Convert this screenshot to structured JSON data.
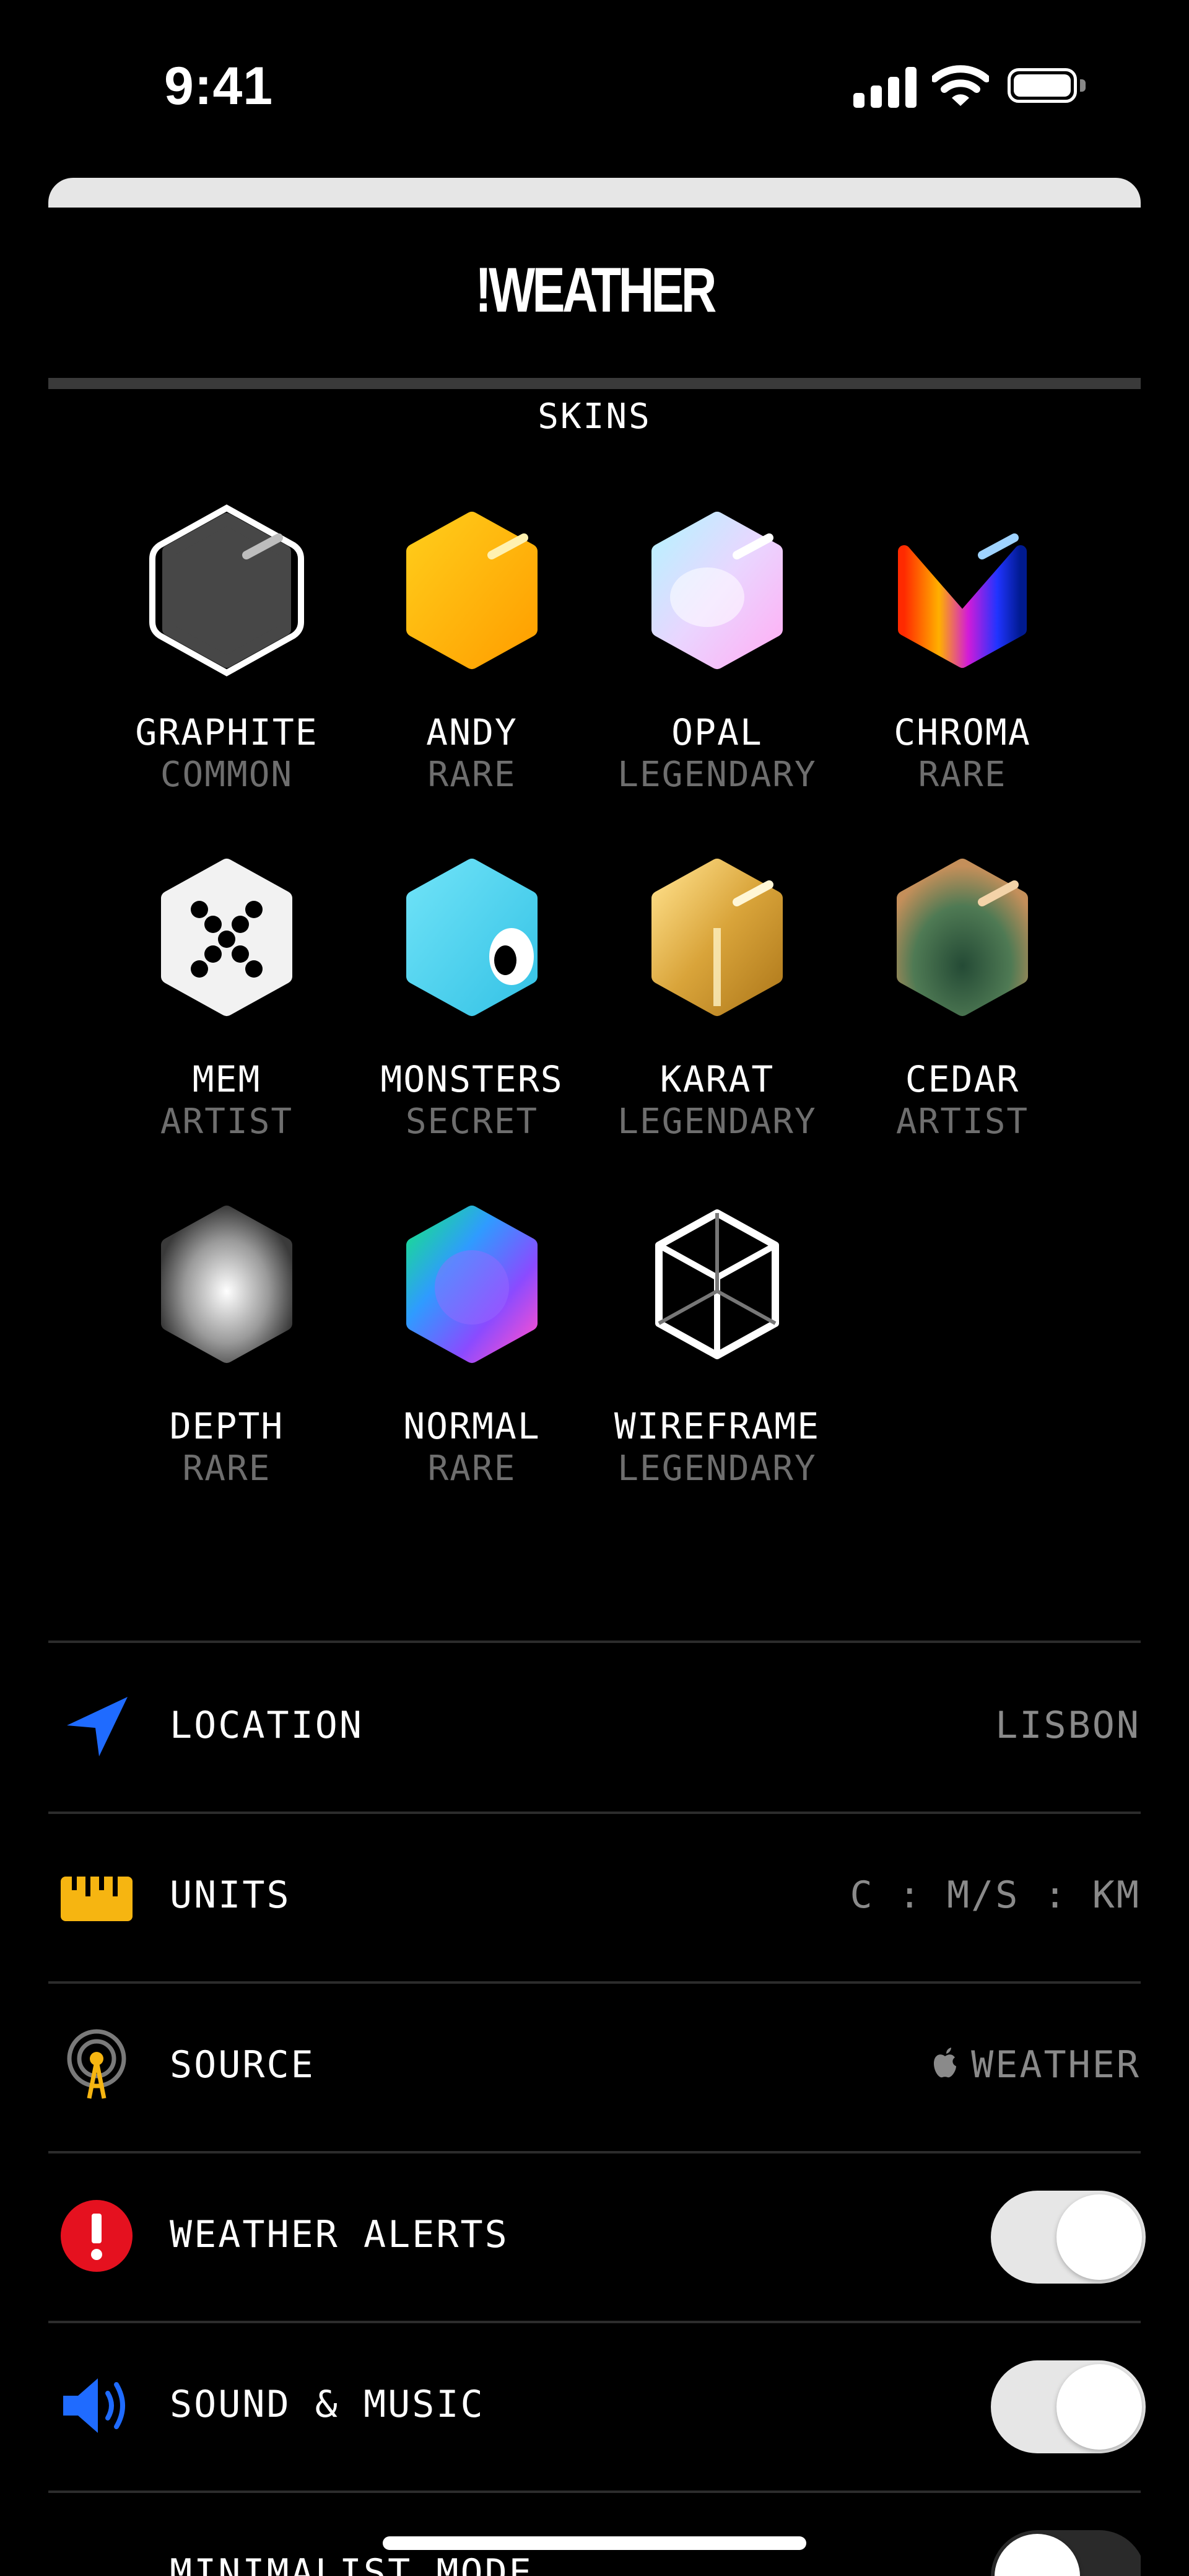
{
  "status_bar": {
    "time": "9:41"
  },
  "app": {
    "title": "!WEATHER"
  },
  "skins_section": {
    "label": "SKINS"
  },
  "skins": [
    {
      "name": "GRAPHITE",
      "rarity": "COMMON",
      "icon": "graphite-skin-icon",
      "selected": true
    },
    {
      "name": "ANDY",
      "rarity": "RARE",
      "icon": "andy-skin-icon"
    },
    {
      "name": "OPAL",
      "rarity": "LEGENDARY",
      "icon": "opal-skin-icon"
    },
    {
      "name": "CHROMA",
      "rarity": "RARE",
      "icon": "chroma-skin-icon"
    },
    {
      "name": "MEM",
      "rarity": "ARTIST",
      "icon": "mem-skin-icon"
    },
    {
      "name": "MONSTERS",
      "rarity": "SECRET",
      "icon": "monsters-skin-icon"
    },
    {
      "name": "KARAT",
      "rarity": "LEGENDARY",
      "icon": "karat-skin-icon"
    },
    {
      "name": "CEDAR",
      "rarity": "ARTIST",
      "icon": "cedar-skin-icon"
    },
    {
      "name": "DEPTH",
      "rarity": "RARE",
      "icon": "depth-skin-icon"
    },
    {
      "name": "NORMAL",
      "rarity": "RARE",
      "icon": "normal-skin-icon"
    },
    {
      "name": "WIREFRAME",
      "rarity": "LEGENDARY",
      "icon": "wireframe-skin-icon"
    }
  ],
  "settings": {
    "location": {
      "label": "LOCATION",
      "value": "LISBON",
      "icon": "location-arrow-icon"
    },
    "units": {
      "label": "UNITS",
      "value": "C : M/S : KM",
      "icon": "ruler-icon"
    },
    "source": {
      "label": "SOURCE",
      "value": "WEATHER",
      "icon": "antenna-icon",
      "value_icon": "apple-logo-icon"
    },
    "alerts": {
      "label": "WEATHER ALERTS",
      "enabled": true,
      "icon": "alert-icon"
    },
    "sound": {
      "label": "SOUND & MUSIC",
      "enabled": true,
      "icon": "speaker-icon"
    },
    "minimalist": {
      "label": "MINIMALIST MODE",
      "enabled": false
    }
  },
  "colors": {
    "background": "#000000",
    "muted_text": "#6e6e6e",
    "toggle_on": "#e6e6e6",
    "alert_red": "#e5111f",
    "units_yellow": "#f6b511",
    "location_blue": "#1f6bff"
  }
}
